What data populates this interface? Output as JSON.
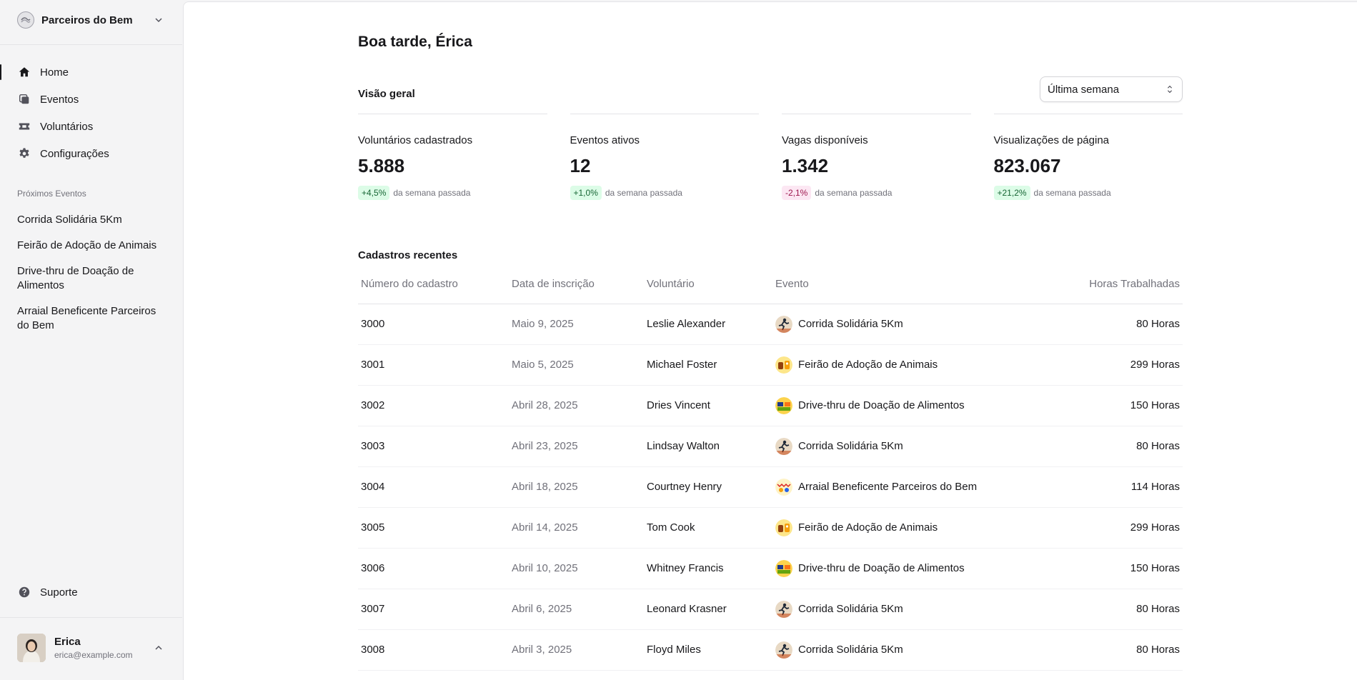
{
  "sidebar": {
    "team_name": "Parceiros do Bem",
    "nav": [
      {
        "label": "Home",
        "icon": "home-icon",
        "current": true
      },
      {
        "label": "Eventos",
        "icon": "square-stack-icon",
        "current": false
      },
      {
        "label": "Voluntários",
        "icon": "ticket-icon",
        "current": false
      },
      {
        "label": "Configurações",
        "icon": "gear-icon",
        "current": false
      }
    ],
    "events_title": "Próximos Eventos",
    "events": [
      "Corrida Solidária 5Km",
      "Feirão de Adoção de Animais",
      "Drive-thru de Doação de Alimentos",
      "Arraial Beneficente Parceiros do Bem"
    ],
    "support_label": "Suporte",
    "user": {
      "name": "Erica",
      "email": "erica@example.com"
    }
  },
  "main": {
    "greeting": "Boa tarde, Érica",
    "overview_title": "Visão geral",
    "period": "Última semana",
    "stats": [
      {
        "label": "Voluntários cadastrados",
        "value": "5.888",
        "change": "+4,5%",
        "trend": "up",
        "suffix": "da semana passada"
      },
      {
        "label": "Eventos ativos",
        "value": "12",
        "change": "+1,0%",
        "trend": "up",
        "suffix": "da semana passada"
      },
      {
        "label": "Vagas disponíveis",
        "value": "1.342",
        "change": "-2,1%",
        "trend": "down",
        "suffix": "da semana passada"
      },
      {
        "label": "Visualizações de página",
        "value": "823.067",
        "change": "+21,2%",
        "trend": "up",
        "suffix": "da semana passada"
      }
    ],
    "table_title": "Cadastros recentes",
    "columns": [
      "Número do cadastro",
      "Data de inscrição",
      "Voluntário",
      "Evento",
      "Horas Trabalhadas"
    ],
    "rows": [
      {
        "id": "3000",
        "date": "Maio 9, 2025",
        "volunteer": "Leslie Alexander",
        "event": "Corrida Solidária 5Km",
        "hours": "80 Horas"
      },
      {
        "id": "3001",
        "date": "Maio 5, 2025",
        "volunteer": "Michael Foster",
        "event": "Feirão de Adoção de Animais",
        "hours": "299 Horas"
      },
      {
        "id": "3002",
        "date": "Abril 28, 2025",
        "volunteer": "Dries Vincent",
        "event": "Drive-thru de Doação de Alimentos",
        "hours": "150 Horas"
      },
      {
        "id": "3003",
        "date": "Abril 23, 2025",
        "volunteer": "Lindsay Walton",
        "event": "Corrida Solidária 5Km",
        "hours": "80 Horas"
      },
      {
        "id": "3004",
        "date": "Abril 18, 2025",
        "volunteer": "Courtney Henry",
        "event": "Arraial Beneficente Parceiros do Bem",
        "hours": "114 Horas"
      },
      {
        "id": "3005",
        "date": "Abril 14, 2025",
        "volunteer": "Tom Cook",
        "event": "Feirão de Adoção de Animais",
        "hours": "299 Horas"
      },
      {
        "id": "3006",
        "date": "Abril 10, 2025",
        "volunteer": "Whitney Francis",
        "event": "Drive-thru de Doação de Alimentos",
        "hours": "150 Horas"
      },
      {
        "id": "3007",
        "date": "Abril 6, 2025",
        "volunteer": "Leonard Krasner",
        "event": "Corrida Solidária 5Km",
        "hours": "80 Horas"
      },
      {
        "id": "3008",
        "date": "Abril 3, 2025",
        "volunteer": "Floyd Miles",
        "event": "Corrida Solidária 5Km",
        "hours": "80 Horas"
      }
    ]
  }
}
